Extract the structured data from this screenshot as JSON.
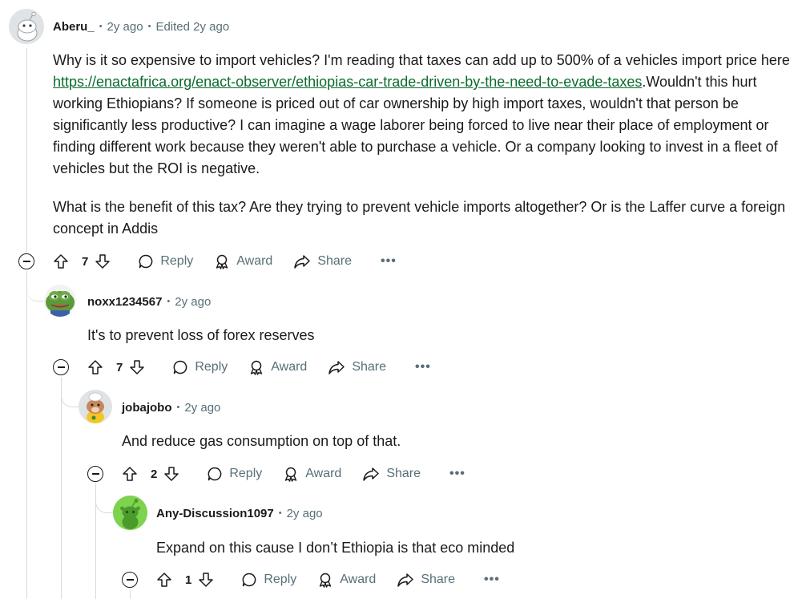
{
  "comments": [
    {
      "username": "Aberu_",
      "age": "2y ago",
      "edited": "Edited 2y ago",
      "body_before_link": "Why is it so expensive to import vehicles? I'm reading that taxes can add up to 500% of a vehicles import price here ",
      "link": "https://enactafrica.org/enact-observer/ethiopias-car-trade-driven-by-the-need-to-evade-taxes",
      "body_after_link": ".Wouldn't this hurt working Ethiopians? If someone is priced out of car ownership by high import taxes, wouldn't that person be significantly less productive? I can imagine a wage laborer being forced to live near their place of employment or finding different work because they weren't able to purchase a vehicle. Or a company looking to invest in a fleet of vehicles but the ROI is negative.",
      "body_p2": "What is the benefit of this tax? Are they trying to prevent vehicle imports altogether? Or is the Laffer curve a foreign concept in Addis",
      "votes": "7",
      "reply_label": "Reply",
      "award_label": "Award",
      "share_label": "Share",
      "more_label": "•••"
    },
    {
      "username": "noxx1234567",
      "age": "2y ago",
      "body": "It's to prevent loss of forex reserves",
      "votes": "7",
      "reply_label": "Reply",
      "award_label": "Award",
      "share_label": "Share",
      "more_label": "•••"
    },
    {
      "username": "jobajobo",
      "age": "2y ago",
      "body": "And reduce gas consumption on top of that.",
      "votes": "2",
      "reply_label": "Reply",
      "award_label": "Award",
      "share_label": "Share",
      "more_label": "•••"
    },
    {
      "username": "Any-Discussion1097",
      "age": "2y ago",
      "body": "Expand on this cause I don’t Ethiopia is that eco minded",
      "votes": "1",
      "reply_label": "Reply",
      "award_label": "Award",
      "share_label": "Share",
      "more_label": "•••"
    }
  ],
  "separator": "•",
  "icons": [
    "avatar-snoo",
    "avatar-frog",
    "avatar-snoo-chef",
    "avatar-snoo-green",
    "upvote-icon",
    "downvote-icon",
    "reply-bubble-icon",
    "award-icon",
    "share-icon",
    "collapse-icon"
  ],
  "colors": {
    "link": "#0b6b2e",
    "meta": "#576f76",
    "thread": "#d7dadc",
    "avatar_green": "#7dd34e"
  }
}
